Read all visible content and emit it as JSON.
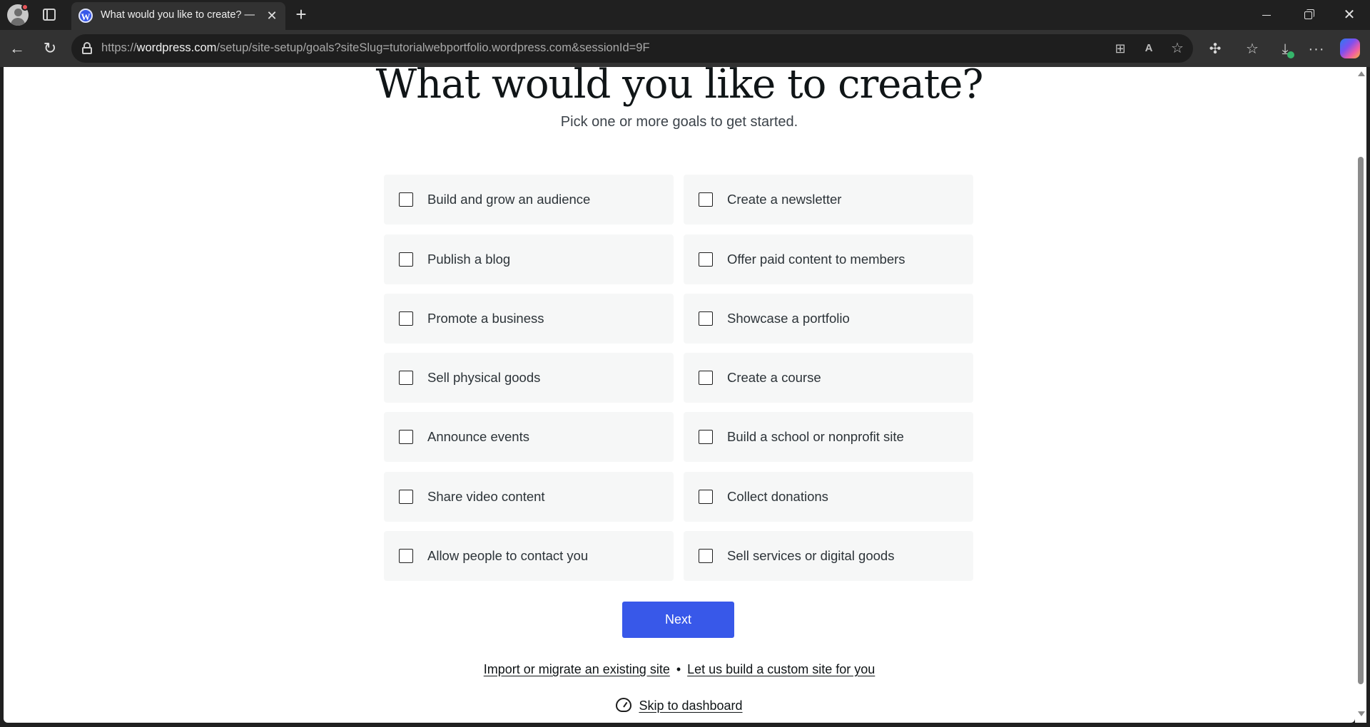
{
  "browser": {
    "tab_title": "What would you like to create? —",
    "tab_favicon": "wordpress-logo-icon",
    "url_prefix": "https://",
    "url_host": "wordpress.com",
    "url_path": "/setup/site-setup/goals?siteSlug=tutorialwebportfolio.wordpress.com&sessionId=9F",
    "icons": [
      "profile-avatar-icon",
      "tab-actions-icon",
      "close-icon",
      "new-tab-icon",
      "back-icon",
      "reload-icon",
      "lock-icon",
      "split-screen-icon",
      "read-aloud-icon",
      "favorite-star-icon",
      "extensions-icon",
      "favorites-icon",
      "downloads-icon",
      "more-icon",
      "copilot-icon"
    ]
  },
  "page": {
    "heading": "What would you like to create?",
    "subheading": "Pick one or more goals to get started.",
    "goals": [
      {
        "label": "Build and grow an audience",
        "checked": false
      },
      {
        "label": "Create a newsletter",
        "checked": false
      },
      {
        "label": "Publish a blog",
        "checked": false
      },
      {
        "label": "Offer paid content to members",
        "checked": false
      },
      {
        "label": "Promote a business",
        "checked": false
      },
      {
        "label": "Showcase a portfolio",
        "checked": false
      },
      {
        "label": "Sell physical goods",
        "checked": false
      },
      {
        "label": "Create a course",
        "checked": false
      },
      {
        "label": "Announce events",
        "checked": false
      },
      {
        "label": "Build a school or nonprofit site",
        "checked": false
      },
      {
        "label": "Share video content",
        "checked": false
      },
      {
        "label": "Collect donations",
        "checked": false
      },
      {
        "label": "Allow people to contact you",
        "checked": false
      },
      {
        "label": "Sell services or digital goods",
        "checked": false
      }
    ],
    "next_label": "Next",
    "import_link": "Import or migrate an existing site",
    "separator": "•",
    "custom_site_link": "Let us build a custom site for you",
    "skip_link": "Skip to dashboard"
  },
  "colors": {
    "accent": "#3858e9",
    "card_bg": "#f6f7f7",
    "text": "#101517"
  }
}
